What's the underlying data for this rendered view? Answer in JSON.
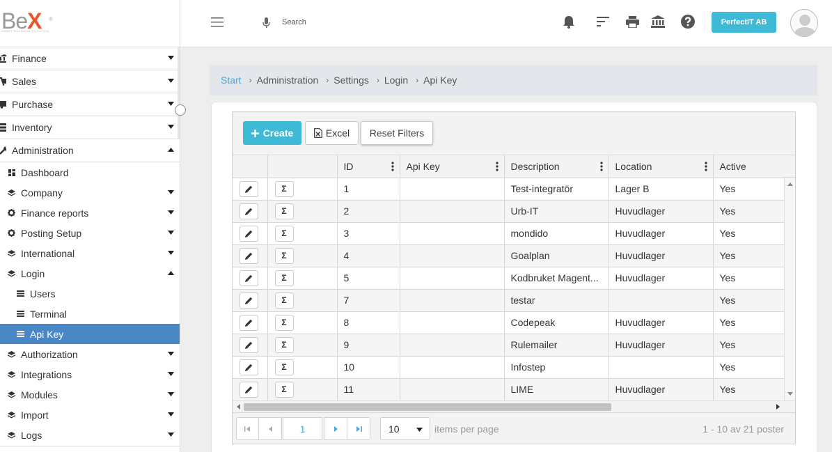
{
  "app": {
    "logo_main": "Be",
    "logo_x": "X",
    "logo_tm": "®",
    "logo_sub": "SMART BUSINESS SOLUTION"
  },
  "sidebar": {
    "top_items": [
      {
        "label": "Finance",
        "icon": "bank-icon",
        "expanded": false
      },
      {
        "label": "Sales",
        "icon": "cart-icon",
        "expanded": false
      },
      {
        "label": "Purchase",
        "icon": "truck-icon",
        "expanded": false
      },
      {
        "label": "Inventory",
        "icon": "inventory-icon",
        "expanded": false
      },
      {
        "label": "Administration",
        "icon": "wrench-icon",
        "expanded": true
      }
    ],
    "admin_items": [
      {
        "label": "Dashboard",
        "icon": "dashboard-icon",
        "has_arrow": false
      },
      {
        "label": "Company",
        "icon": "layers-icon",
        "has_arrow": true
      },
      {
        "label": "Finance reports",
        "icon": "gear-icon",
        "has_arrow": true
      },
      {
        "label": "Posting Setup",
        "icon": "gear-icon",
        "has_arrow": true
      },
      {
        "label": "International",
        "icon": "layers-icon",
        "has_arrow": true
      },
      {
        "label": "Login",
        "icon": "layers-icon",
        "has_arrow": true,
        "expanded": true
      }
    ],
    "login_items": [
      {
        "label": "Users",
        "icon": "list-icon"
      },
      {
        "label": "Terminal",
        "icon": "list-icon"
      },
      {
        "label": "Api Key",
        "icon": "list-icon",
        "active": true
      }
    ],
    "more_items": [
      {
        "label": "Authorization",
        "icon": "layers-icon"
      },
      {
        "label": "Integrations",
        "icon": "layers-icon"
      },
      {
        "label": "Modules",
        "icon": "layers-icon"
      },
      {
        "label": "Import",
        "icon": "layers-icon"
      },
      {
        "label": "Logs",
        "icon": "layers-icon"
      }
    ]
  },
  "topbar": {
    "search_placeholder": "Search",
    "company_button": "PerfectIT AB"
  },
  "breadcrumb": {
    "start": "Start",
    "items": [
      "Administration",
      "Settings",
      "Login",
      "Api Key"
    ]
  },
  "toolbar": {
    "create_label": "Create",
    "excel_label": "Excel",
    "reset_label": "Reset Filters"
  },
  "table": {
    "columns": [
      "ID",
      "Api Key",
      "Description",
      "Location",
      "Active"
    ],
    "rows": [
      {
        "id": "1",
        "api_key": "",
        "description": "Test-integratör",
        "location": "Lager B",
        "active": "Yes"
      },
      {
        "id": "2",
        "api_key": "",
        "description": "Urb-IT",
        "location": "Huvudlager",
        "active": "Yes"
      },
      {
        "id": "3",
        "api_key": "",
        "description": "mondido",
        "location": "Huvudlager",
        "active": "Yes"
      },
      {
        "id": "4",
        "api_key": "",
        "description": "Goalplan",
        "location": "Huvudlager",
        "active": "Yes"
      },
      {
        "id": "5",
        "api_key": "",
        "description": "Kodbruket Magent...",
        "location": "Huvudlager",
        "active": "Yes"
      },
      {
        "id": "7",
        "api_key": "",
        "description": "testar",
        "location": "",
        "active": "Yes"
      },
      {
        "id": "8",
        "api_key": "",
        "description": "Codepeak",
        "location": "Huvudlager",
        "active": "Yes"
      },
      {
        "id": "9",
        "api_key": "",
        "description": "Rulemailer",
        "location": "Huvudlager",
        "active": "Yes"
      },
      {
        "id": "10",
        "api_key": "",
        "description": "Infostep",
        "location": "",
        "active": "Yes"
      },
      {
        "id": "11",
        "api_key": "",
        "description": "LIME",
        "location": "Huvudlager",
        "active": "Yes"
      }
    ],
    "edit_icon": "pencil-icon",
    "sum_symbol": "Σ"
  },
  "pager": {
    "current_page": "1",
    "page_size": "10",
    "items_per_page_label": "items per page",
    "info": "1 - 10 av 21 poster"
  },
  "colors": {
    "accent": "#3fbad6",
    "active_nav": "#4a87c6",
    "breadcrumb_link": "#4aa7d8",
    "logo_x": "#e8572c"
  }
}
